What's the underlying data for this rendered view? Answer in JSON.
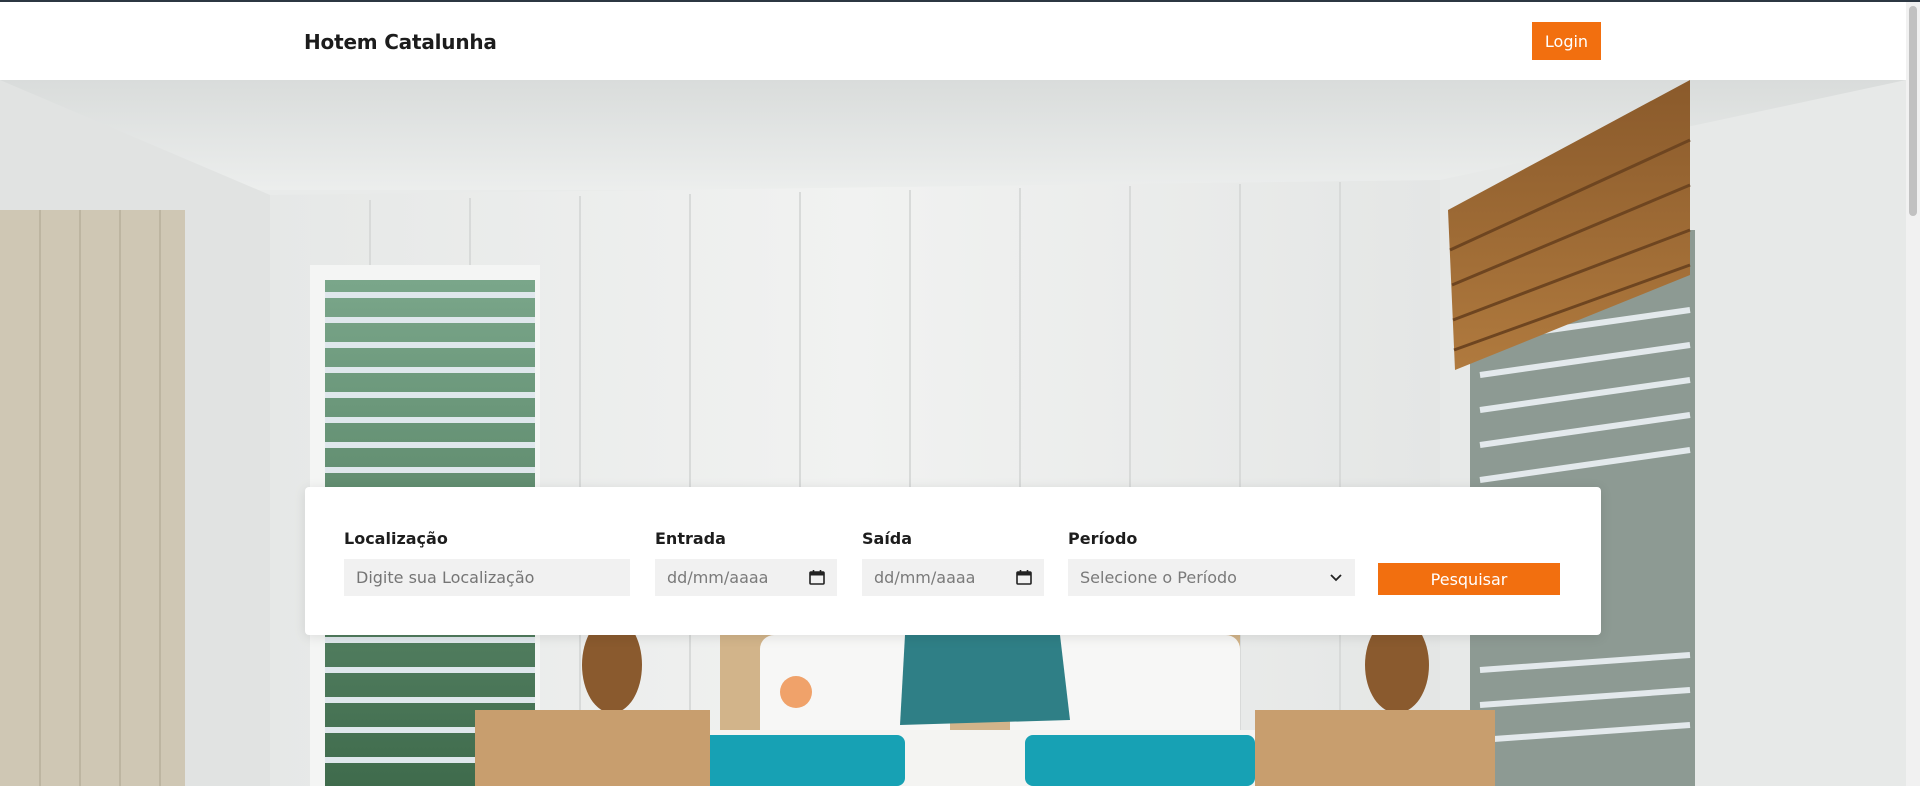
{
  "navbar": {
    "brand": "Hotem Catalunha",
    "login_label": "Login"
  },
  "hero": {
    "image": "bedroom-photo"
  },
  "search": {
    "location_label": "Localização",
    "location_placeholder": "Digite sua Localização",
    "checkin_label": "Entrada",
    "checkin_value": "dd/mm/aaaa",
    "checkout_label": "Saída",
    "checkout_value": "dd/mm/aaaa",
    "period_label": "Período",
    "period_selected": "Selecione o Período",
    "submit_label": "Pesquisar"
  },
  "colors": {
    "accent": "#f26f0f",
    "field_bg": "#f1f1f1",
    "text": "#1d1d1d"
  }
}
